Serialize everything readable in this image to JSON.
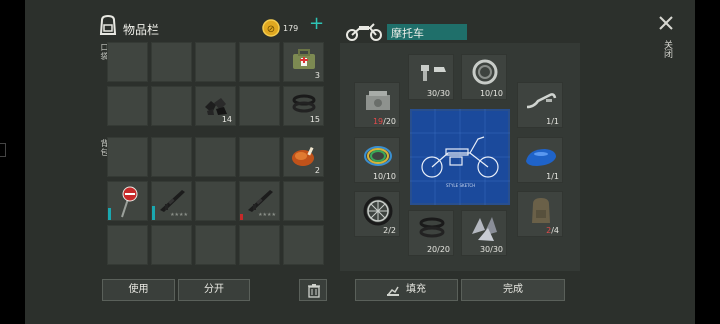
{
  "header": {
    "inventory_title": "物品栏",
    "coins": "179",
    "add_symbol": "+",
    "craft_title": "摩托车"
  },
  "sections": {
    "pocket": "口袋",
    "backpack": "背包"
  },
  "inventory_items": {
    "medkit_qty": "3",
    "coal_qty": "14",
    "tires_qty": "15",
    "chicken_qty": "2",
    "stars": "★★★★"
  },
  "recipe_slots": {
    "bolts": "30/30",
    "bearing": "10/10",
    "engine_have": "19",
    "engine_need": "/20",
    "handlebar": "1/1",
    "wires": "10/10",
    "fuel_tank": "1/1",
    "wheel": "2/2",
    "gaskets": "20/20",
    "metal_scraps": "30/30",
    "backpack_have": "2",
    "backpack_need": "/4"
  },
  "blueprint_caption": "STYLE SKETCH",
  "buttons": {
    "use": "使用",
    "split": "分开",
    "fill": "填充",
    "done": "完成",
    "close": "关闭"
  },
  "colors": {
    "background": "#2c302c",
    "accent_teal": "#1aa8b0",
    "craft_title_bg": "#1f6f6a",
    "warning_red": "#e24b4b",
    "blueprint_blue": "#1b4a9c"
  }
}
